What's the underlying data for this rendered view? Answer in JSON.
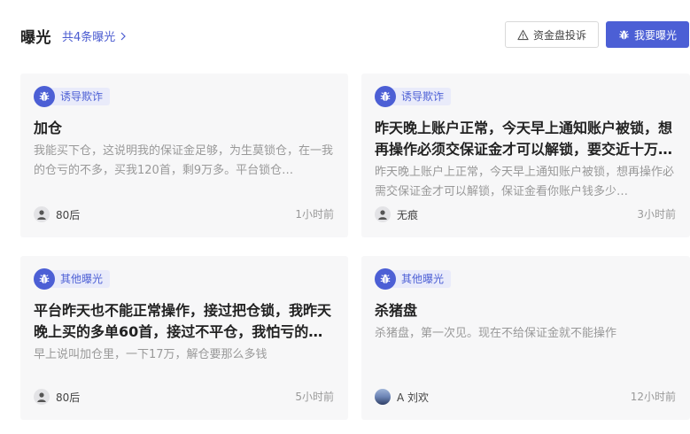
{
  "header": {
    "title": "曝光",
    "count_link": "共4条曝光",
    "complain_button": "资金盘投诉",
    "expose_button": "我要曝光"
  },
  "cards": [
    {
      "tag": "诱导欺诈",
      "title": "加仓",
      "desc": "我能买下仓，这说明我的保证金足够，为生莫锁仓，在一我的仓亏的不多，买我120首，剩9万多。平台锁仓…",
      "author": "80后",
      "time": "1小时前"
    },
    {
      "tag": "诱导欺诈",
      "title": "昨天晚上账户正常，今天早上通知账户被锁，想再操作必须交保证金才可以解锁，要交近十万…",
      "desc": "昨天晚上账户上正常，今天早上通知账户被锁，想再操作必需交保证金才可以解锁，保证金看你账户钱多少…",
      "author": "无痕",
      "time": "3小时前"
    },
    {
      "tag": "其他曝光",
      "title": "平台昨天也不能正常操作，接过把仓锁，我昨天晚上买的多单60首，接过不平仓，我怕亏的…",
      "desc": "早上说叫加仓里，一下17万，解仓要那么多钱",
      "author": "80后",
      "time": "5小时前"
    },
    {
      "tag": "其他曝光",
      "title": "杀猪盘",
      "desc": "杀猪盘，第一次见。现在不给保证金就不能操作",
      "author": "A 刘欢",
      "time": "12小时前"
    }
  ],
  "colors": {
    "accent": "#4c5fd5",
    "tag_bg": "#e9ebfa",
    "card_bg": "#f7f7f8"
  }
}
